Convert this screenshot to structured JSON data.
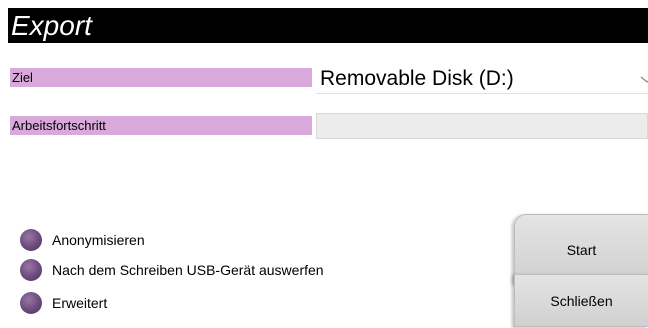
{
  "dialog": {
    "title": "Export"
  },
  "destination": {
    "label": "Ziel",
    "value": "Removable Disk (D:)"
  },
  "progress": {
    "label": "Arbeitsfortschritt",
    "value": 0
  },
  "options": [
    {
      "label": "Anonymisieren"
    },
    {
      "label": "Nach dem Schreiben USB-Gerät auswerfen"
    },
    {
      "label": "Erweitert"
    }
  ],
  "buttons": {
    "start": "Start",
    "close": "Schließen"
  },
  "colors": {
    "label_bg": "#d8a9da",
    "radio": "#6a4a7a",
    "title_bg": "#000000"
  },
  "icons": {
    "dropdown": "chevron-down-icon",
    "radio": "radio-button-icon"
  }
}
